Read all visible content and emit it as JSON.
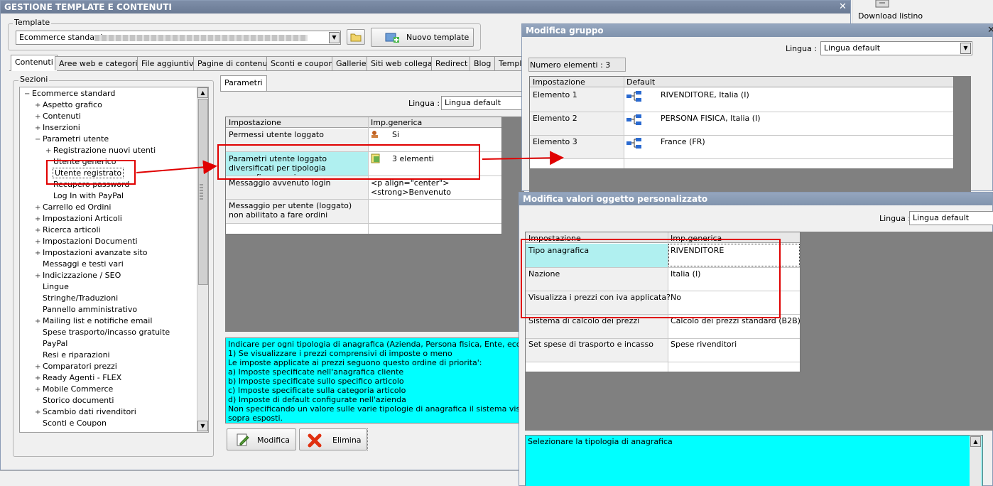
{
  "main": {
    "title": "GESTIONE TEMPLATE E CONTENUTI",
    "template_label": "Template",
    "template_value": "Ecommerce standard",
    "new_template_label": "Nuovo template",
    "tabs": [
      "Contenuti",
      "Aree web e categorie",
      "File aggiuntivi",
      "Pagine di contenuti",
      "Sconti e coupon",
      "Gallerie",
      "Siti web collegati",
      "Redirect",
      "Blog",
      "Templa"
    ],
    "sections_label": "Sezioni",
    "params_tab": "Parametri",
    "lingua_label": "Lingua :",
    "lingua_value": "Lingua default",
    "tree": [
      {
        "label": "Ecommerce standard",
        "indent": 0,
        "prefix": "−"
      },
      {
        "label": "Aspetto grafico",
        "indent": 1,
        "prefix": "+"
      },
      {
        "label": "Contenuti",
        "indent": 1,
        "prefix": "+"
      },
      {
        "label": "Inserzioni",
        "indent": 1,
        "prefix": "+"
      },
      {
        "label": "Parametri utente",
        "indent": 1,
        "prefix": "−"
      },
      {
        "label": "Registrazione nuovi utenti",
        "indent": 2,
        "prefix": "+"
      },
      {
        "label": "Utente generico",
        "indent": 2,
        "prefix": ""
      },
      {
        "label": "Utente registrato",
        "indent": 2,
        "prefix": ""
      },
      {
        "label": "Recupero password",
        "indent": 2,
        "prefix": ""
      },
      {
        "label": "Log In with PayPal",
        "indent": 2,
        "prefix": ""
      },
      {
        "label": "Carrello ed Ordini",
        "indent": 1,
        "prefix": "+"
      },
      {
        "label": "Impostazioni Articoli",
        "indent": 1,
        "prefix": "+"
      },
      {
        "label": "Ricerca articoli",
        "indent": 1,
        "prefix": "+"
      },
      {
        "label": "Impostazioni Documenti",
        "indent": 1,
        "prefix": "+"
      },
      {
        "label": "Impostazioni avanzate sito",
        "indent": 1,
        "prefix": "+"
      },
      {
        "label": "Messaggi e testi vari",
        "indent": 1,
        "prefix": ""
      },
      {
        "label": "Indicizzazione / SEO",
        "indent": 1,
        "prefix": "+"
      },
      {
        "label": "Lingue",
        "indent": 1,
        "prefix": ""
      },
      {
        "label": "Stringhe/Traduzioni",
        "indent": 1,
        "prefix": ""
      },
      {
        "label": "Pannello amministrativo",
        "indent": 1,
        "prefix": ""
      },
      {
        "label": "Mailing list e notifiche email",
        "indent": 1,
        "prefix": "+"
      },
      {
        "label": "Spese trasporto/incasso gratuite",
        "indent": 1,
        "prefix": ""
      },
      {
        "label": "PayPal",
        "indent": 1,
        "prefix": ""
      },
      {
        "label": "Resi e riparazioni",
        "indent": 1,
        "prefix": ""
      },
      {
        "label": "Comparatori prezzi",
        "indent": 1,
        "prefix": "+"
      },
      {
        "label": "Ready Agenti - FLEX",
        "indent": 1,
        "prefix": "+"
      },
      {
        "label": "Mobile Commerce",
        "indent": 1,
        "prefix": "+"
      },
      {
        "label": "Storico documenti",
        "indent": 1,
        "prefix": ""
      },
      {
        "label": "Scambio dati rivenditori",
        "indent": 1,
        "prefix": "+"
      },
      {
        "label": "Sconti e Coupon",
        "indent": 1,
        "prefix": ""
      }
    ],
    "grid_headers": [
      "Impostazione",
      "Imp.generica"
    ],
    "grid_rows": [
      {
        "setting": "Permessi utente loggato",
        "value": "Si"
      },
      {
        "setting": "Parametri utente loggato diversificati per tipologia anagrafica e nazione",
        "value": "3 elementi"
      },
      {
        "setting": "Messaggio avvenuto login",
        "value": "<p align=\"center\"><strong>Benvenuto"
      },
      {
        "setting": "Messaggio per utente (loggato) non abilitato a fare ordini",
        "value": ""
      }
    ],
    "description": [
      "Indicare per ogni tipologia di anagrafica (Azienda, Persona fisica, Ente, ecc..) e nazio",
      "1) Se visualizzare i prezzi comprensivi di imposte o meno",
      "Le imposte applicate ai prezzi seguono questo ordine di priorita':",
      "a) Imposte specificate nell'anagrafica cliente",
      "b) Imposte specificate sullo specifico articolo",
      "c) Imposte specificate sulla categoria articolo",
      "d) Imposte di default configurate nell'azienda",
      "Non specificando un valore sulle varie tipologie di anagrafica il sistema visualizzera' di d",
      "sopra esposti."
    ],
    "modifica_label": "Modifica",
    "elimina_label": "Elimina"
  },
  "download_label": "Download listino",
  "group": {
    "title": "Modifica gruppo",
    "lingua_label": "Lingua :",
    "lingua_value": "Lingua default",
    "count_label": "Numero elementi : 3",
    "headers": [
      "Impostazione",
      "Default"
    ],
    "rows": [
      {
        "name": "Elemento 1",
        "value": "RIVENDITORE, Italia (I)"
      },
      {
        "name": "Elemento 2",
        "value": "PERSONA FISICA, Italia (I)"
      },
      {
        "name": "Elemento 3",
        "value": "France (FR)"
      }
    ]
  },
  "custom": {
    "title": "Modifica valori oggetto personalizzato",
    "lingua_label": "Lingua :",
    "lingua_value": "Lingua default",
    "headers": [
      "Impostazione",
      "Imp.generica"
    ],
    "rows": [
      {
        "setting": "Tipo anagrafica",
        "value": "RIVENDITORE"
      },
      {
        "setting": "Nazione",
        "value": "Italia (I)"
      },
      {
        "setting": "Visualizza i prezzi con iva applicata?",
        "value": "No"
      },
      {
        "setting": "Sistema di calcolo dei prezzi",
        "value": "Calcolo dei prezzi standard (B2B)"
      },
      {
        "setting": "Set spese di trasporto e incasso",
        "value": "Spese rivenditori"
      }
    ],
    "description": "Selezionare la tipologia di anagrafica"
  },
  "colors": {
    "highlight": "#00ffff",
    "selected_cell": "#b0f0f0",
    "annotation": "#e00000"
  }
}
